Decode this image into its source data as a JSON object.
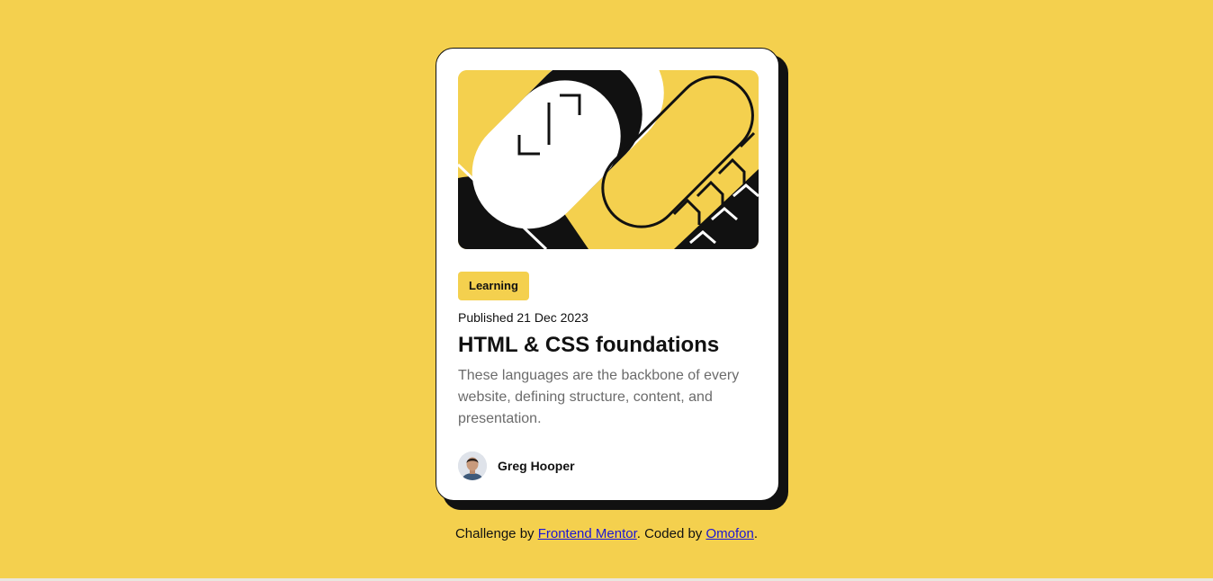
{
  "colors": {
    "background": "#f4d04e",
    "card": "#ffffff",
    "ink": "#111111",
    "muted": "#6b6b6b",
    "link": "#1a14d6"
  },
  "card": {
    "hero_image": "abstract-illustration",
    "tag": "Learning",
    "published": "Published 21 Dec 2023",
    "title": "HTML & CSS foundations",
    "description": "These languages are the backbone of every website, defining structure, content, and presentation.",
    "author": {
      "avatar": "author-avatar",
      "name": "Greg Hooper"
    }
  },
  "attribution": {
    "prefix": "Challenge by ",
    "link1": "Frontend Mentor",
    "middle": ". Coded by ",
    "link2": "Omofon",
    "suffix": "."
  }
}
